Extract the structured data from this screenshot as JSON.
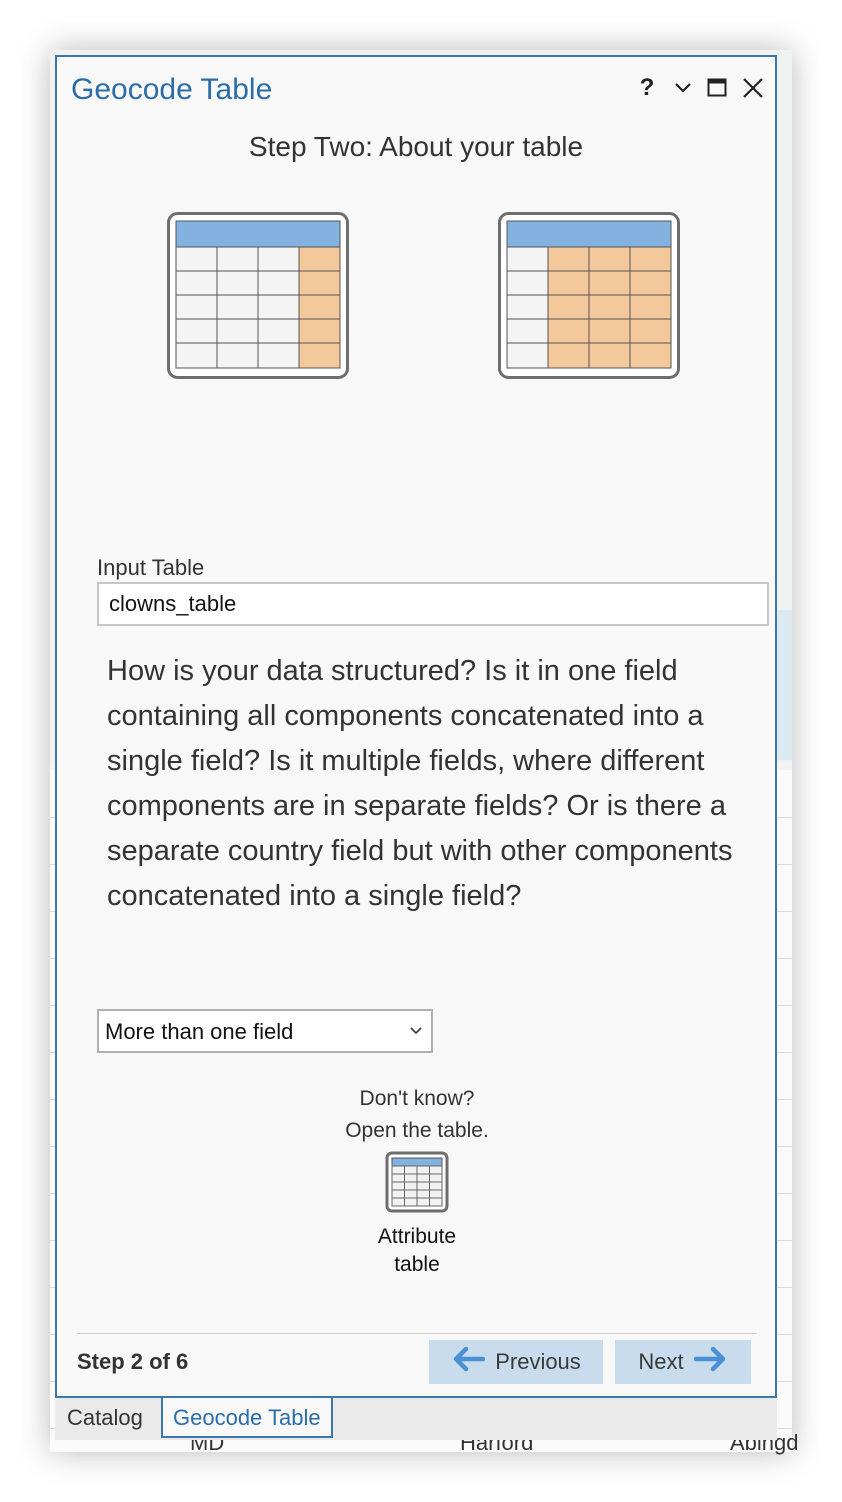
{
  "window": {
    "title": "Geocode Table",
    "help_label": "?",
    "controls": [
      "chevron-down-icon",
      "maximize-icon",
      "close-icon"
    ]
  },
  "step_heading": "Step Two: About your table",
  "input_table": {
    "label": "Input Table",
    "value": "clowns_table"
  },
  "question": "How is your data structured? Is it in one field containing all components concatenated into a single field? Is it multiple fields, where different components are in separate fields? Or is there a separate country field but with other components concatenated into a single field?",
  "structure_select": {
    "value": "More than one field"
  },
  "help_hint": {
    "line1": "Don't know?",
    "line2": "Open the table."
  },
  "attribute_table": {
    "line1": "Attribute",
    "line2": "table"
  },
  "footer": {
    "step_label": "Step 2 of 6",
    "previous_label": "Previous",
    "next_label": "Next"
  },
  "tabs": [
    {
      "label": "Catalog",
      "active": false
    },
    {
      "label": "Geocode Table",
      "active": true
    }
  ],
  "background_table": {
    "bottom_row": [
      "MD",
      "Harford",
      "Abingd"
    ]
  },
  "colors": {
    "accent": "#2b6da8",
    "header_blue": "#83b2e0",
    "cell_orange": "#f3c89a",
    "button_bg": "#c8dced"
  }
}
